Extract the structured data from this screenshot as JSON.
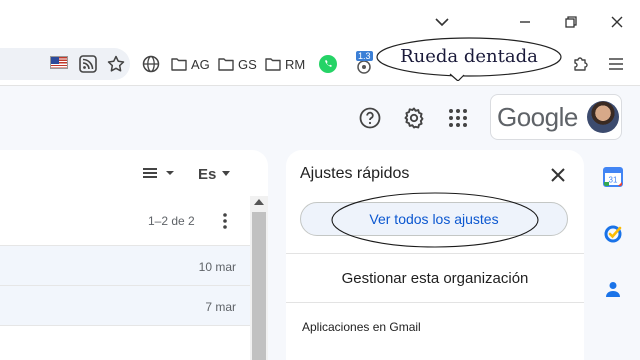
{
  "callout": {
    "text": "Rueda dentada"
  },
  "bookmarks": [
    {
      "label": "AG"
    },
    {
      "label": "GS"
    },
    {
      "label": "RM"
    }
  ],
  "extension_badge": "1.3",
  "header": {
    "logo_text": "Google"
  },
  "mail_list": {
    "language": "Es",
    "page_count": "1–2 de 2",
    "rows": [
      {
        "date": "10 mar"
      },
      {
        "date": "7 mar"
      }
    ]
  },
  "quick_settings": {
    "title": "Ajustes rápidos",
    "see_all_label": "Ver todos los ajustes",
    "manage_label": "Gestionar esta organización",
    "apps_heading": "Aplicaciones en Gmail"
  },
  "colors": {
    "accent_blue": "#0b57d0",
    "panel_bg": "#ffffff",
    "page_bg": "#f6f8fc"
  },
  "icons": [
    "chevron-down-icon",
    "minimize-icon",
    "restore-icon",
    "close-icon",
    "flag-icon",
    "rss-icon",
    "star-icon",
    "globe-icon",
    "folder-icon",
    "whatsapp-icon",
    "puzzle-icon",
    "menu-icon",
    "help-icon",
    "gear-icon",
    "apps-icon",
    "calendar-icon",
    "tasks-icon",
    "contacts-icon"
  ]
}
